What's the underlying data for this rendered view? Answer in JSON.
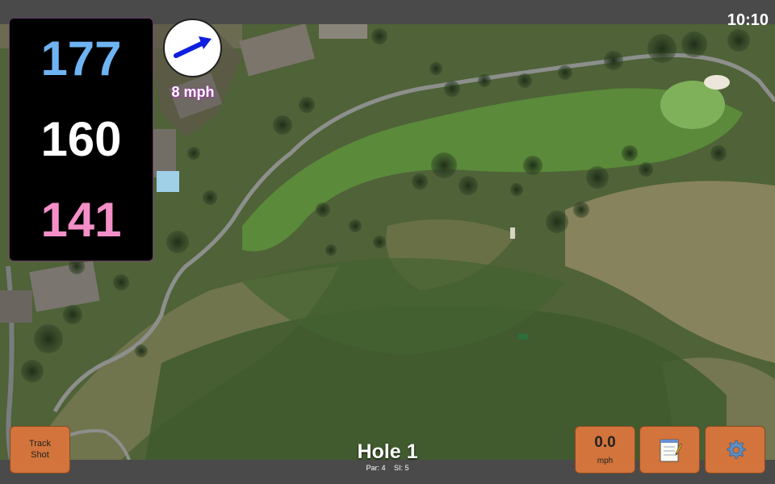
{
  "status": {
    "time": "10:10"
  },
  "distances": {
    "back": "177",
    "center": "160",
    "front": "141"
  },
  "wind": {
    "speed": "8 mph",
    "icon": "wind-arrow-icon"
  },
  "hole": {
    "title": "Hole 1",
    "par": "Par: 4",
    "stroke_index": "SI: 5"
  },
  "buttons": {
    "track_shot": "Track\nShot",
    "speed_value": "0.0",
    "speed_unit": "mph",
    "notes_icon": "notepad-icon",
    "settings_icon": "gear-icon"
  },
  "colors": {
    "back_distance": "#6fb4f2",
    "center_distance": "#ffffff",
    "front_distance": "#f48fc8",
    "button": "#d2743b",
    "wind_label_glow": "#9b3ea0"
  }
}
